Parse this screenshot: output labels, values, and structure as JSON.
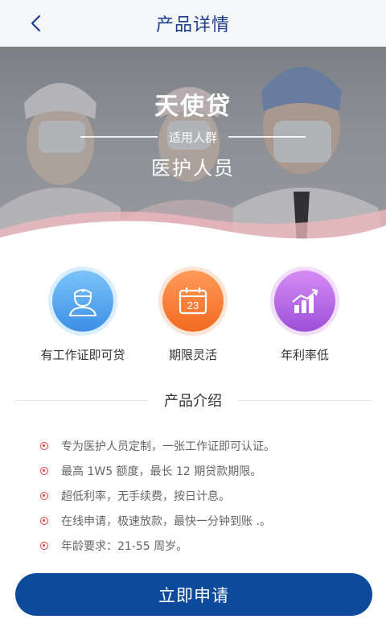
{
  "header": {
    "title": "产品详情",
    "back_icon": "chevron-left-icon"
  },
  "banner": {
    "title": "天使贷",
    "subtitle": "适用人群",
    "target": "医护人员"
  },
  "features": [
    {
      "label": "有工作证即可贷",
      "icon": "nurse-id-icon",
      "color": "#3c8fe6"
    },
    {
      "label": "期限灵活",
      "icon": "calendar-icon",
      "color": "#f26a22",
      "day": "23"
    },
    {
      "label": "年利率低",
      "icon": "bar-chart-icon",
      "color": "#9d4fd8"
    }
  ],
  "intro": {
    "title": "产品介绍",
    "items": [
      "专为医护人员定制，一张工作证即可认证。",
      "最高 1W5 额度，最长 12 期贷款期限。",
      "超低利率，无手续费，按日计息。",
      "在线申请，极速放款，最快一分钟到账 .。",
      "年龄要求：21-55 周岁。"
    ]
  },
  "apply_button": {
    "label": "立即申请",
    "color": "#0e4a9c"
  }
}
